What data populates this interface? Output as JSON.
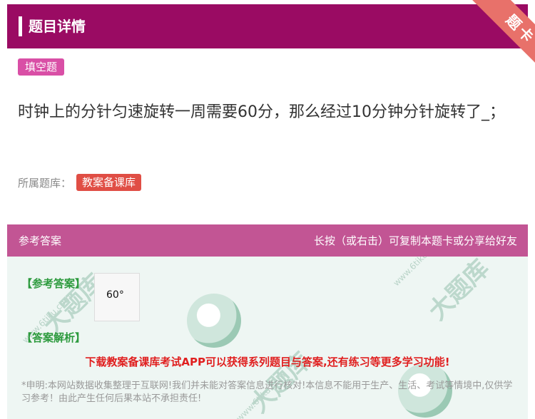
{
  "header": {
    "title": "题目详情",
    "badge": "题卡"
  },
  "question_type": "填空题",
  "question_text": "时钟上的分针匀速旋转一周需要60分，那么经过10分钟分针旋转了_；",
  "library": {
    "label": "所属题库：",
    "name": "教案备课库"
  },
  "answer_section": {
    "title": "参考答案",
    "hint": "长按（或右击）可复制本题卡或分享给好友",
    "answer_label": "【参考答案】",
    "answer_value": "60°",
    "analysis_label": "【答案解析】",
    "promo": "下载教案备课库考试APP可以获得系列题目与答案,还有练习等更多学习功能!",
    "disclaimer": "*申明:本网站数据收集整理于互联网!我们并未能对答案信息进行核对!本信息不能用于生产、生活、考试等情境中,仅供学习参考！由此产生任何后果本站不承担责任!"
  },
  "colors": {
    "header": "#9a0b63",
    "answer_header": "#c25594",
    "type_tag": "#d94fa6",
    "library_tag": "#e04e45",
    "promo": "#e01f1f"
  }
}
